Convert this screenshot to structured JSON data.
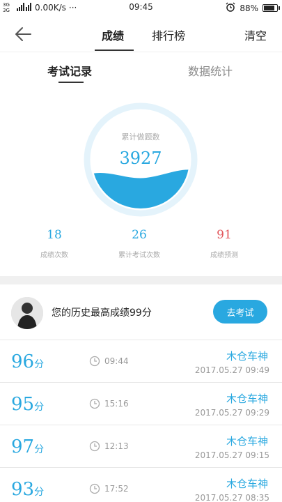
{
  "status_bar": {
    "network": "3G 3G",
    "speed": "0.00K/s",
    "dots": "···",
    "time": "09:45",
    "battery": "88%"
  },
  "nav": {
    "tabs": [
      {
        "label": "成绩",
        "active": true
      },
      {
        "label": "排行榜",
        "active": false
      }
    ],
    "clear_label": "清空"
  },
  "sub_tabs": [
    {
      "label": "考试记录",
      "active": true
    },
    {
      "label": "数据统计",
      "active": false
    }
  ],
  "gauge": {
    "label": "累计做题数",
    "value": "3927"
  },
  "stats": [
    {
      "value": "18",
      "label": "成绩次数"
    },
    {
      "value": "26",
      "label": "累计考试次数"
    },
    {
      "value": "91",
      "label": "成绩预测"
    }
  ],
  "best": {
    "text": "您的历史最高成绩99分",
    "button_label": "去考试"
  },
  "records": [
    {
      "score": "96",
      "unit": "分",
      "duration": "09:44",
      "title": "木仓车神",
      "date": "2017.05.27  09:49"
    },
    {
      "score": "95",
      "unit": "分",
      "duration": "15:16",
      "title": "木仓车神",
      "date": "2017.05.27  09:29"
    },
    {
      "score": "97",
      "unit": "分",
      "duration": "12:13",
      "title": "木仓车神",
      "date": "2017.05.27  09:15"
    },
    {
      "score": "93",
      "unit": "分",
      "duration": "17:52",
      "title": "木仓车神",
      "date": "2017.05.27  08:35"
    }
  ],
  "colors": {
    "accent": "#29a8e0",
    "prediction": "#e2575c"
  }
}
